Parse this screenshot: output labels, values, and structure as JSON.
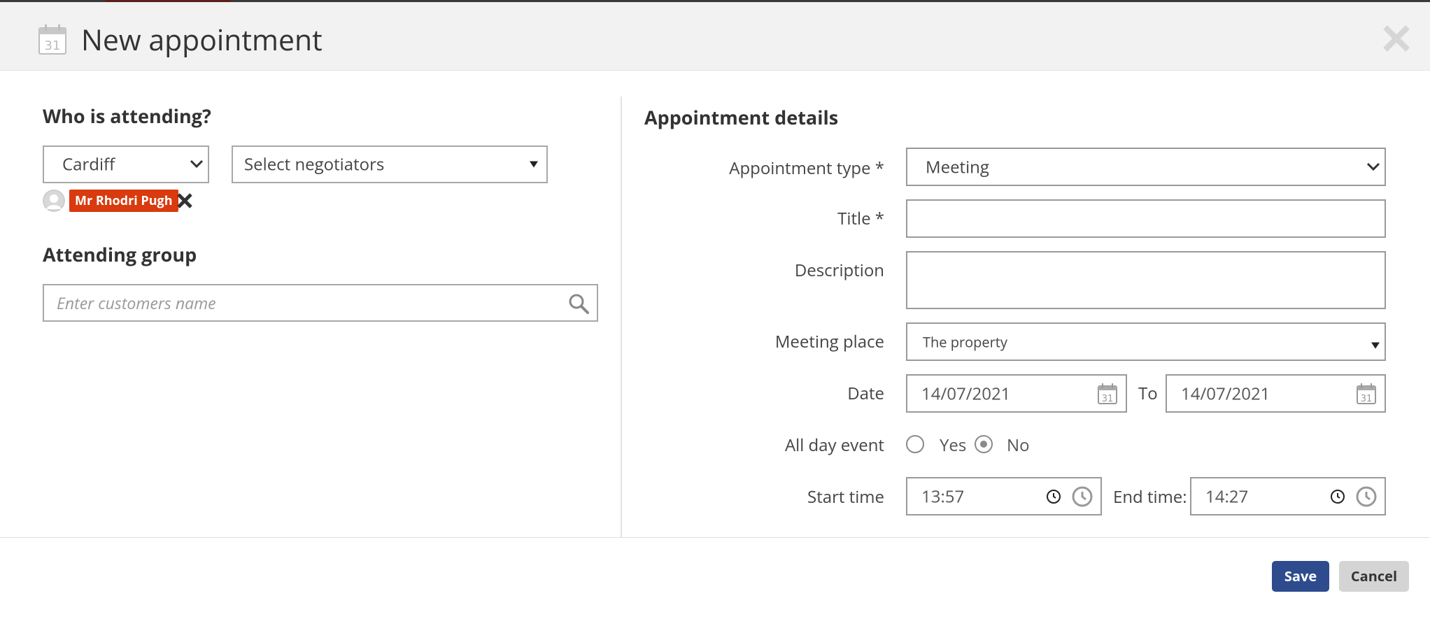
{
  "dialog": {
    "title": "New appointment"
  },
  "attending": {
    "heading": "Who is attending?",
    "office_select": "Cardiff",
    "negotiator_select": "Select negotiators",
    "selected_negotiator": "Mr Rhodri Pugh"
  },
  "group": {
    "heading": "Attending group",
    "search_placeholder": "Enter customers name"
  },
  "details": {
    "heading": "Appointment details",
    "type_label": "Appointment type *",
    "type_value": "Meeting",
    "title_label": "Title *",
    "title_value": "",
    "description_label": "Description",
    "description_value": "",
    "place_label": "Meeting place",
    "place_value": "The property",
    "date_label": "Date",
    "date_from": "14/07/2021",
    "date_to_label": "To",
    "date_to": "14/07/2021",
    "all_day_label": "All day event",
    "all_day_yes": "Yes",
    "all_day_no": "No",
    "all_day_selected": "No",
    "start_label": "Start time",
    "start_value": "13:57",
    "end_label": "End time:",
    "end_value": "14:27"
  },
  "footer": {
    "save_label": "Save",
    "cancel_label": "Cancel"
  },
  "colors": {
    "badge": "#d93a0e",
    "save_button": "#2e4b8e",
    "cancel_button": "#d4d4d4",
    "header_bg": "#f2f2f2"
  }
}
